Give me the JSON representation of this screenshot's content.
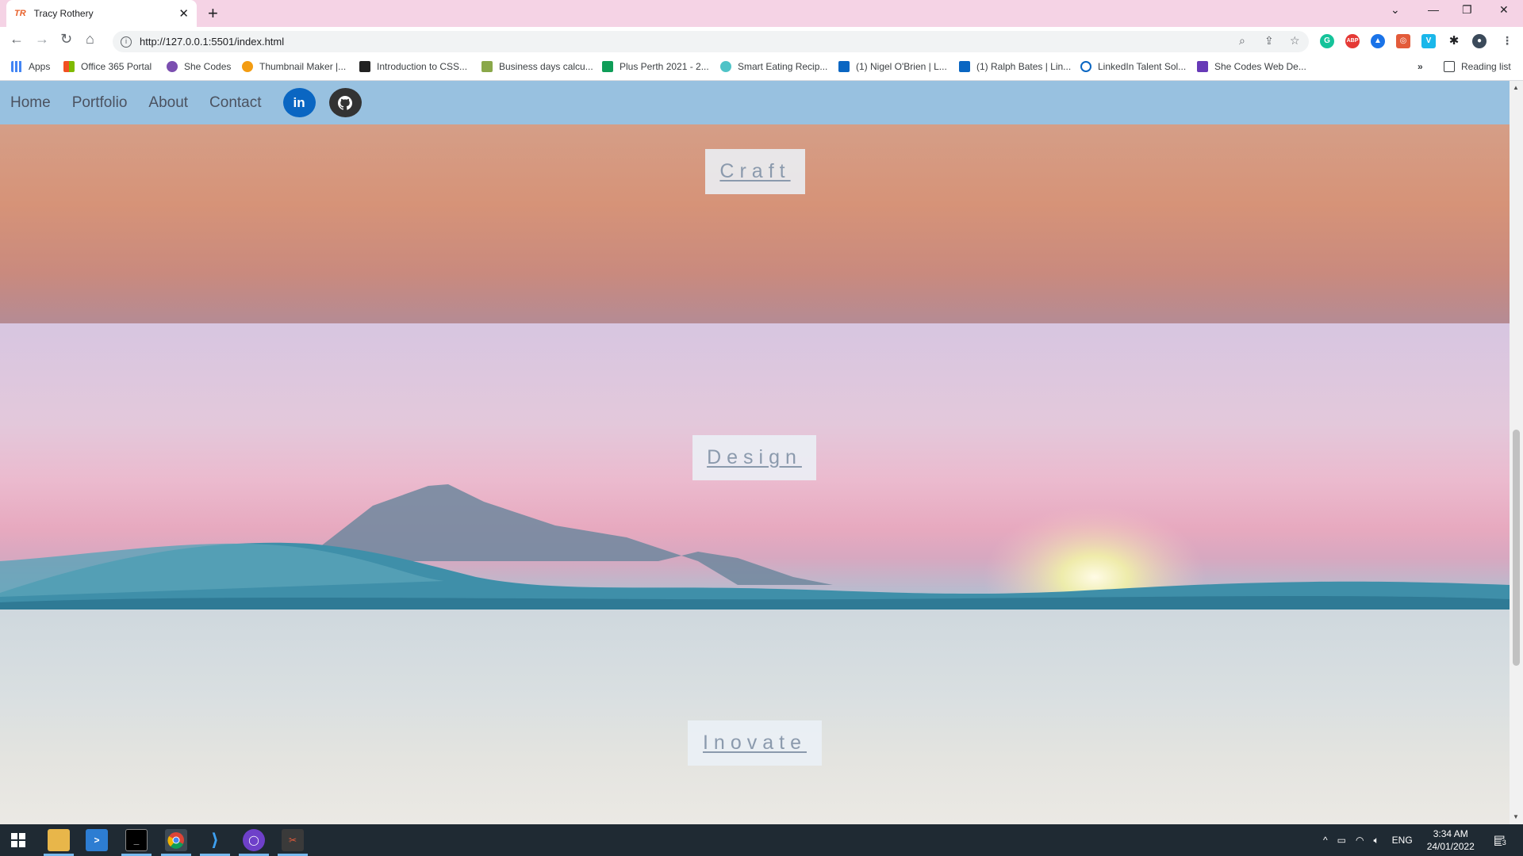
{
  "browser": {
    "tab_title": "Tracy Rothery",
    "tab_favicon": "TR",
    "url": "http://127.0.0.1:5501/index.html",
    "bookmarks": [
      {
        "label": "Apps",
        "icon": "apps-grid-icon",
        "color": "#4285f4"
      },
      {
        "label": "Office 365 Portal",
        "icon": "office-icon",
        "color": "#e74c3c"
      },
      {
        "label": "She Codes",
        "icon": "she-codes-icon",
        "color": "#7b4fb0"
      },
      {
        "label": "Thumbnail Maker |...",
        "icon": "thumbnail-maker-icon",
        "color": "#f39c12"
      },
      {
        "label": "Introduction to CSS...",
        "icon": "css-intro-icon",
        "color": "#222222"
      },
      {
        "label": "Business days calcu...",
        "icon": "calendar-icon",
        "color": "#8aa84a"
      },
      {
        "label": "Plus Perth 2021 - 2...",
        "icon": "sheets-icon",
        "color": "#0f9d58"
      },
      {
        "label": "Smart Eating Recip...",
        "icon": "smart-eating-icon",
        "color": "#4fc3c7"
      },
      {
        "label": "(1) Nigel O'Brien | L...",
        "icon": "linkedin-icon",
        "color": "#0a66c2"
      },
      {
        "label": "(1) Ralph Bates | Lin...",
        "icon": "linkedin-icon",
        "color": "#0a66c2"
      },
      {
        "label": "LinkedIn Talent Sol...",
        "icon": "search-icon",
        "color": "#0a66c2"
      },
      {
        "label": "She Codes Web De...",
        "icon": "forms-icon",
        "color": "#673ab7"
      }
    ],
    "reading_list": "Reading list"
  },
  "site": {
    "nav": {
      "home": "Home",
      "portfolio": "Portfolio",
      "about": "About",
      "contact": "Contact",
      "linkedin": "in"
    },
    "sections": {
      "craft": "Craft",
      "design": "Design",
      "inovate": "Inovate"
    }
  },
  "taskbar": {
    "language": "ENG",
    "time": "3:34 AM",
    "date": "24/01/2022",
    "notifications": "3"
  }
}
